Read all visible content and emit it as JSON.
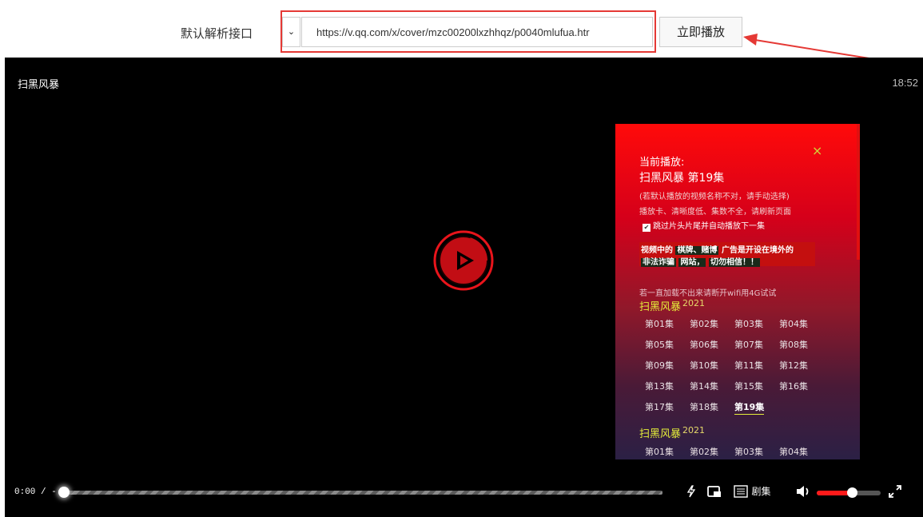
{
  "parser": {
    "label": "默认解析接口",
    "select_arrow": "⌄",
    "url": "https://v.qq.com/x/cover/mzc00200lxzhhqz/p0040mlufua.htr",
    "play_label": "立即播放"
  },
  "player": {
    "title": "扫黑风暴",
    "clock": "18:52",
    "current_time": "0:00 / -",
    "progress": 0,
    "volume": 0.55,
    "episodes_label": "剧集",
    "colors": {
      "accent": "#ff1a1a",
      "episode_highlight": "#e5ee3a"
    }
  },
  "panel": {
    "close": "×",
    "now_playing_label": "当前播放:",
    "now_playing_title": "扫黑风暴 第19集",
    "hint1": "(若默认播放的视频名称不对，请手动选择)",
    "hint2": "播放卡、清晰度低、集数不全，请刷新页面",
    "skip_label": "跳过片头片尾并自动播放下一集",
    "skip_checked": true,
    "warn": {
      "p1": "视频中的",
      "h1": "棋牌、赌博",
      "p2": "广告是开设在境外的",
      "h2": "非法诈骗",
      "h3": "网站，",
      "h4": "切勿相信！！"
    },
    "tip": "若一直加载不出来请断开wifi用4G试试",
    "series": [
      {
        "name": "扫黑风暴",
        "year": "2021",
        "episodes": [
          "第01集",
          "第02集",
          "第03集",
          "第04集",
          "第05集",
          "第06集",
          "第07集",
          "第08集",
          "第09集",
          "第10集",
          "第11集",
          "第12集",
          "第13集",
          "第14集",
          "第15集",
          "第16集",
          "第17集",
          "第18集",
          "第19集"
        ],
        "current": "第19集"
      },
      {
        "name": "扫黑风暴",
        "year": "2021",
        "episodes": [
          "第01集",
          "第02集",
          "第03集",
          "第04集"
        ]
      }
    ]
  }
}
